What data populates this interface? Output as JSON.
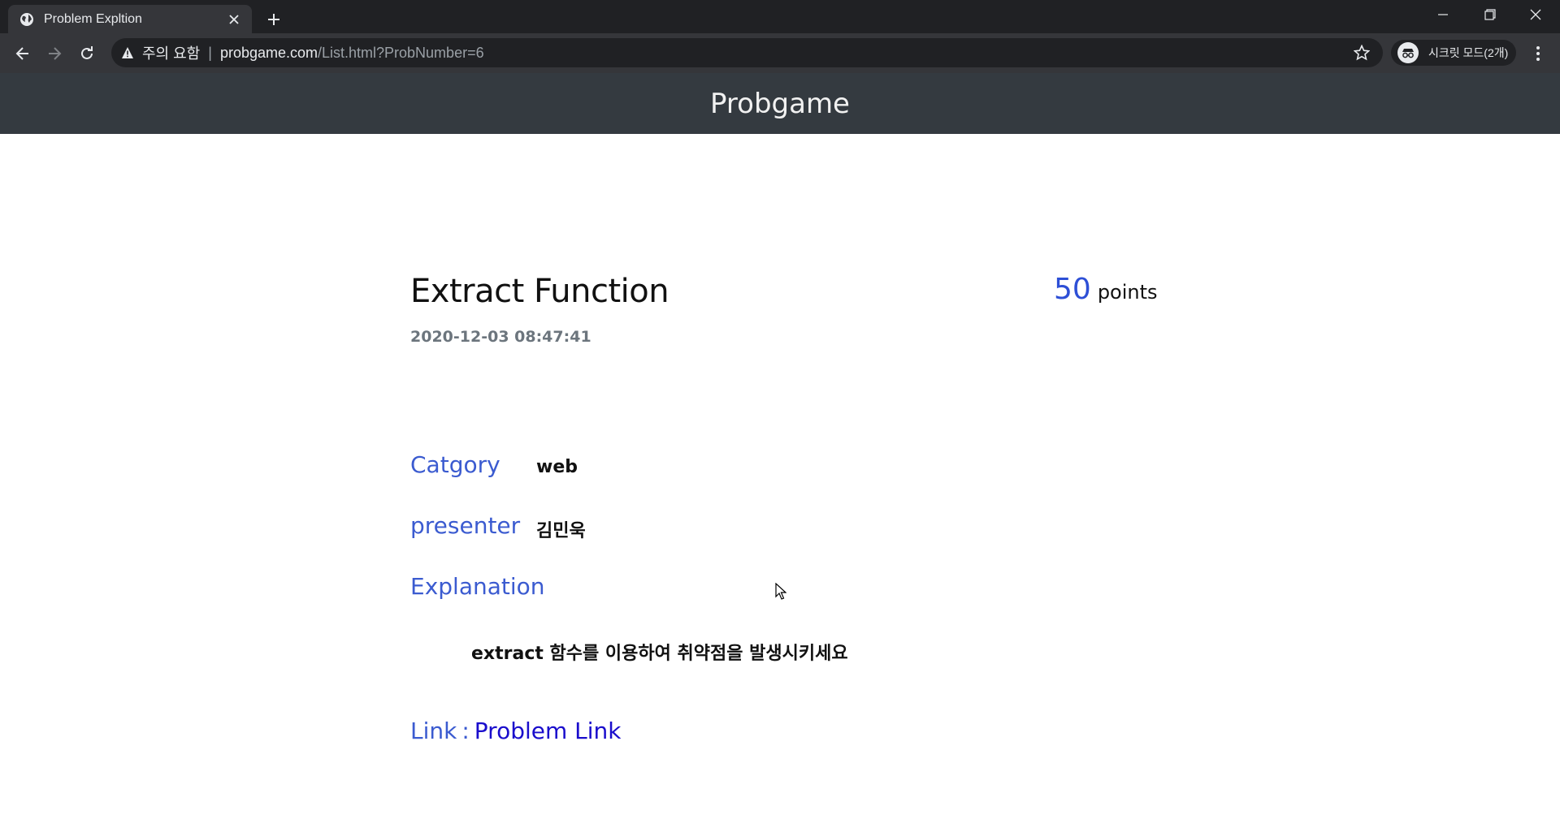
{
  "browser": {
    "tab_title": "Problem Expltion",
    "address": {
      "warning_label": "주의 요함",
      "separator": "|",
      "url_host": "probgame.com",
      "url_path": "/List.html?ProbNumber=6"
    },
    "incognito_label": "시크릿 모드(2개)"
  },
  "site": {
    "title": "Probgame"
  },
  "problem": {
    "title": "Extract Function",
    "date": "2020-12-03 08:47:41",
    "points_value": "50",
    "points_unit": "points",
    "category_label": "Catgory",
    "category_value": "web",
    "presenter_label": "presenter",
    "presenter_value": "김민욱",
    "explanation_label": "Explanation",
    "explanation_text": "extract 함수를 이용하여 취약점을 발생시키세요",
    "link_label": "Link",
    "link_separator": ":",
    "link_text": "Problem Link"
  },
  "colors": {
    "header_bg": "#343a40",
    "accent_blue": "#3b5bd0",
    "points_blue": "#2d4fd6",
    "link_blue": "#1a0dcc",
    "chrome_dark": "#202124",
    "chrome_toolbar": "#35363a"
  },
  "icons": {
    "tab_favicon": "globe-icon",
    "tab_close": "close-icon",
    "new_tab": "plus-icon",
    "back": "arrow-left-icon",
    "forward": "arrow-right-icon",
    "reload": "reload-icon",
    "warning": "warning-triangle-icon",
    "bookmark": "star-icon",
    "incognito": "incognito-icon",
    "menu": "kebab-menu-icon"
  }
}
